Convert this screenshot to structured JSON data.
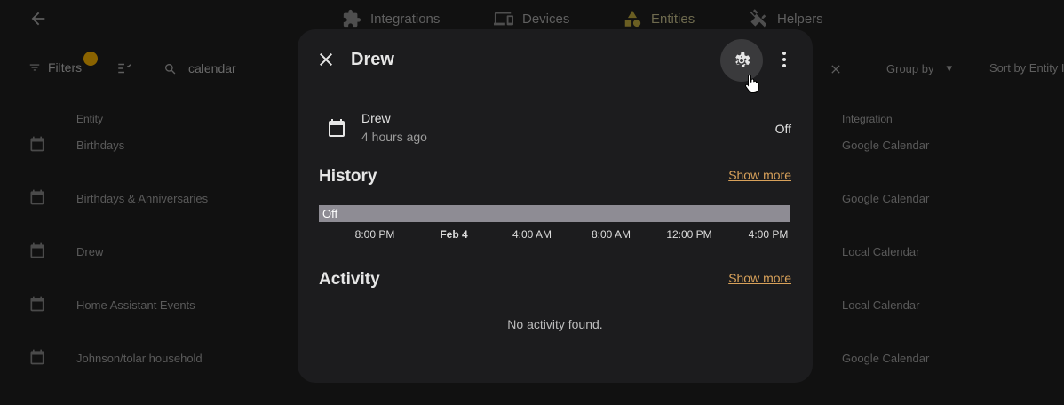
{
  "background": {
    "tabs": [
      {
        "label": "Integrations",
        "icon": "puzzle-icon"
      },
      {
        "label": "Devices",
        "icon": "devices-icon"
      },
      {
        "label": "Entities",
        "icon": "shapes-icon"
      },
      {
        "label": "Helpers",
        "icon": "tools-icon"
      }
    ],
    "filters_label": "Filters",
    "search_value": "calendar",
    "group_by_label": "Group by",
    "sort_by_label": "Sort by Entity ID",
    "columns": {
      "entity": "Entity",
      "integration": "Integration"
    },
    "rows": [
      {
        "name": "Birthdays",
        "integration": "Google Calendar"
      },
      {
        "name": "Birthdays & Anniversaries",
        "integration": "Google Calendar"
      },
      {
        "name": "Drew",
        "integration": "Local Calendar"
      },
      {
        "name": "Home Assistant Events",
        "integration": "Local Calendar"
      },
      {
        "name": "Johnson/tolar household",
        "integration": "Google Calendar"
      }
    ]
  },
  "dialog": {
    "title": "Drew",
    "entity": {
      "name": "Drew",
      "last_changed": "4 hours ago",
      "state": "Off",
      "icon": "calendar-icon"
    },
    "history": {
      "title": "History",
      "show_more": "Show more",
      "bar_label": "Off",
      "ticks": [
        "8:00 PM",
        "Feb 4",
        "4:00 AM",
        "8:00 AM",
        "12:00 PM",
        "4:00 PM"
      ]
    },
    "activity": {
      "title": "Activity",
      "show_more": "Show more",
      "empty": "No activity found."
    }
  },
  "colors": {
    "accent": "#d8a15a",
    "timeline": "#8e8c94",
    "dialog_bg": "#1c1c1e"
  }
}
